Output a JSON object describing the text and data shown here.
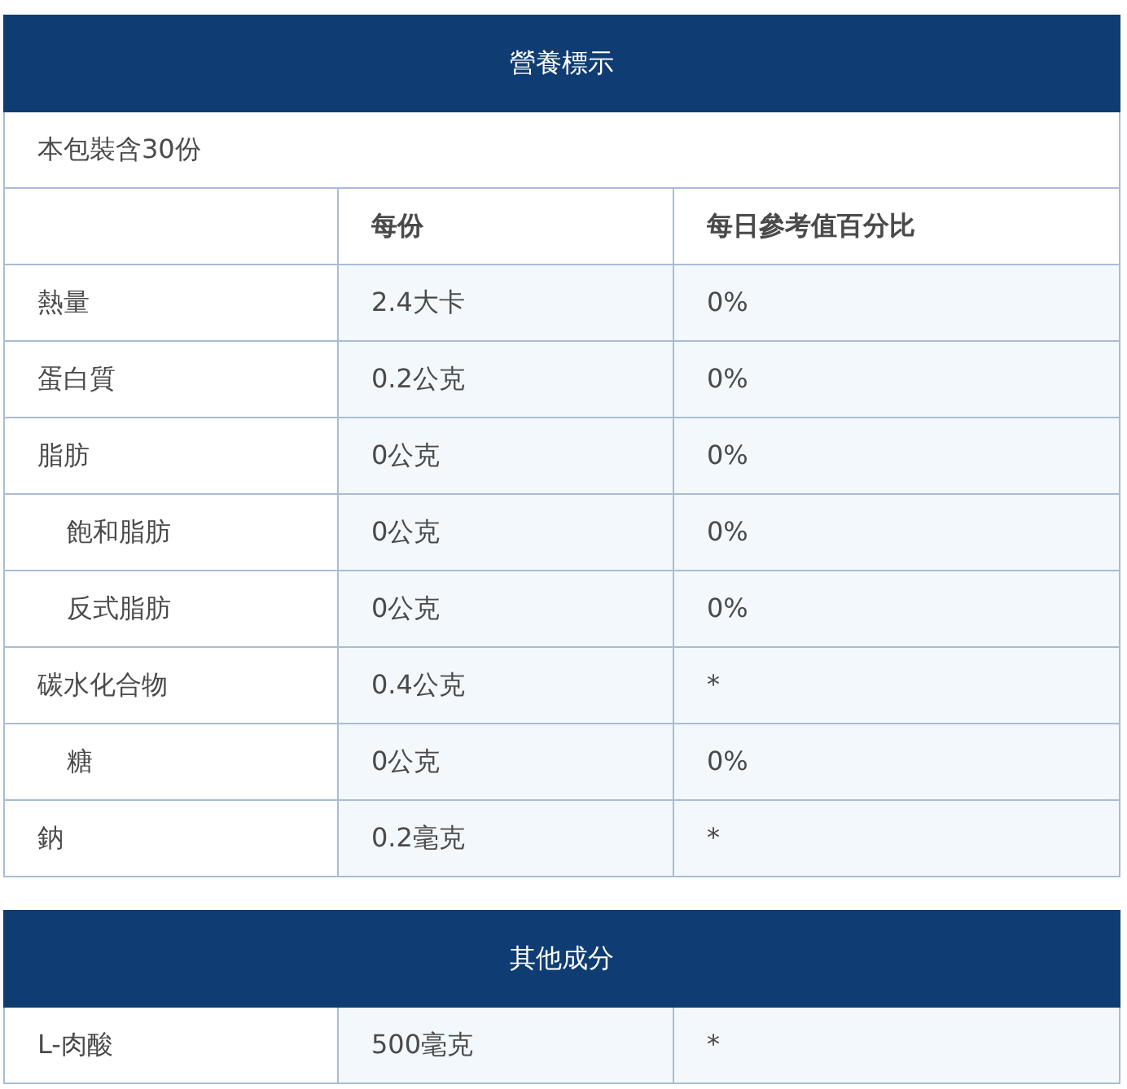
{
  "nutrition_table": {
    "title": "營養標示",
    "servings": "本包裝含30份",
    "columns": [
      "每份",
      "每日參考值百分比"
    ],
    "rows": [
      {
        "name": "熱量",
        "per_serving": "2.4大卡",
        "daily_value": "0%"
      },
      {
        "name": "蛋白質",
        "per_serving": "0.2公克",
        "daily_value": "0%"
      },
      {
        "name": "脂肪",
        "per_serving": "0公克",
        "daily_value": "0%",
        "children": [
          {
            "name": "飽和脂肪",
            "per_serving": "0公克",
            "daily_value": "0%"
          },
          {
            "name": "反式脂肪",
            "per_serving": "0公克",
            "daily_value": "0%"
          }
        ]
      },
      {
        "name": "碳水化合物",
        "per_serving": "0.4公克",
        "daily_value": "*",
        "children": [
          {
            "name": "糖",
            "per_serving": "0公克",
            "daily_value": "0%"
          }
        ]
      },
      {
        "name": "鈉",
        "per_serving": "0.2毫克",
        "daily_value": "*"
      }
    ]
  },
  "other_ingredients": {
    "title": "其他成分",
    "rows": [
      {
        "name": "L-肉酸",
        "per_serving": "500毫克",
        "daily_value": "*"
      }
    ]
  }
}
